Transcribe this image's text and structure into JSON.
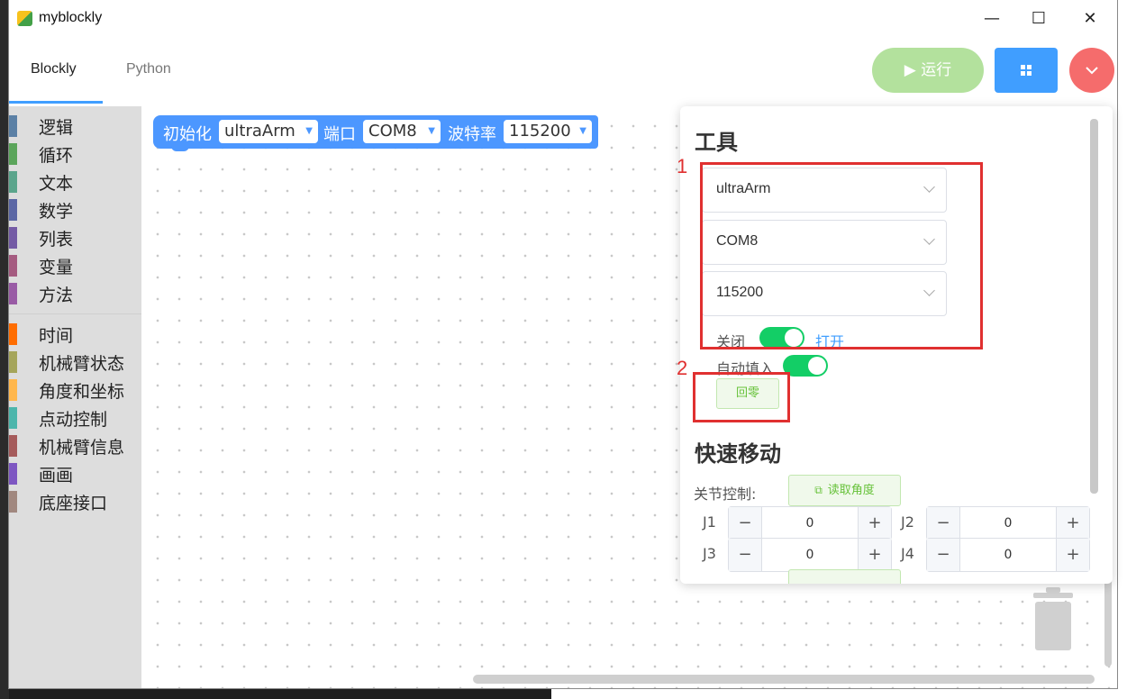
{
  "window": {
    "title": "myblockly",
    "minimize": "—",
    "maximize": "☐",
    "close": "✕"
  },
  "tabs": [
    {
      "label": "Blockly",
      "active": true
    },
    {
      "label": "Python",
      "active": false
    }
  ],
  "toolbar": {
    "run_label": "▶ 运行",
    "colors": {
      "run": "#b3e19d",
      "grid": "#409eff",
      "menu": "#f56c6c"
    }
  },
  "categories": [
    {
      "label": "逻辑",
      "color": "#5b80a5"
    },
    {
      "label": "循环",
      "color": "#5ba55b"
    },
    {
      "label": "文本",
      "color": "#5ba58c"
    },
    {
      "label": "数学",
      "color": "#5b67a5"
    },
    {
      "label": "列表",
      "color": "#745ba5"
    },
    {
      "label": "变量",
      "color": "#a55b80"
    },
    {
      "label": "方法",
      "color": "#995ba5"
    },
    {
      "label": "时间",
      "color": "#ff6d00"
    },
    {
      "label": "机械臂状态",
      "color": "#a5a55b"
    },
    {
      "label": "角度和坐标",
      "color": "#ffb74d"
    },
    {
      "label": "点动控制",
      "color": "#4db6ac"
    },
    {
      "label": "机械臂信息",
      "color": "#a55b5b"
    },
    {
      "label": "画画",
      "color": "#7e57c2"
    },
    {
      "label": "底座接口",
      "color": "#a1887f"
    }
  ],
  "block": {
    "init_label": "初始化",
    "device": "ultraArm",
    "port_label": "端口",
    "port": "COM8",
    "baud_label": "波特率",
    "baud": "115200"
  },
  "panel": {
    "tools_title": "工具",
    "device_select": "ultraArm",
    "port_select": "COM8",
    "baud_select": "115200",
    "close_label": "关闭",
    "open_label": "打开",
    "autofill_label": "自动填入",
    "home_button": "回零",
    "quick_title": "快速移动",
    "joint_label": "关节控制:",
    "read_angle_button": "读取角度",
    "joints": [
      {
        "name": "J1",
        "value": "0"
      },
      {
        "name": "J2",
        "value": "0"
      },
      {
        "name": "J3",
        "value": "0"
      },
      {
        "name": "J4",
        "value": "0"
      }
    ],
    "minus": "−",
    "plus": "+"
  },
  "annotations": {
    "one": "1",
    "two": "2"
  }
}
